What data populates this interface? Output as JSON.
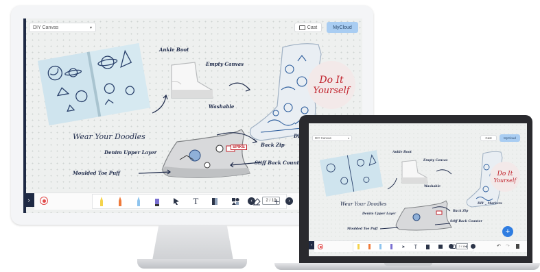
{
  "monitor": {
    "canvas_dropdown": {
      "value": "DIY Canvas"
    },
    "cast_button": "Cast",
    "mycloud_button": "MyCloud",
    "labels": {
      "ankle_boot": "Ankle Boot",
      "empty_canvas": "Empty Canvas",
      "washable": "Washable",
      "wear_your_doodles": "Wear Your Doodles",
      "denim_upper_layer": "Denim Upper Layer",
      "back_zip": "Back Zip",
      "stiff_back_counter": "Stiff Back Count",
      "moulded_toe_puff": "Moulded Toe Puff",
      "di_fragment": "DI",
      "do_it_yourself_1": "Do It",
      "do_it_yourself_2": "Yourself",
      "spike": "SPIKE"
    },
    "page_indicator": "2 / 10"
  },
  "laptop": {
    "canvas_dropdown": {
      "value": "DIY Canvas"
    },
    "cast_button": "Cast",
    "mycloud_button": "MyCloud",
    "labels": {
      "ankle_boot": "Ankle Boot",
      "empty_canvas": "Empty Canvas",
      "washable": "Washable",
      "wear_your_doodles": "Wear Your Doodles",
      "denim_upper_layer": "Denim Upper Layer",
      "back_zip": "Back Zip",
      "stiff_back_counter": "Stiff Back Counter",
      "moulded_toe_puff": "Moulded Toe Puff",
      "diy_markers": "DIY _ Markers",
      "do_it_yourself_1": "Do It",
      "do_it_yourself_2": "Yourself"
    },
    "page_indicator": "2 / 10",
    "fab_label": "+"
  },
  "icons": [
    "chevron-right-icon",
    "record-icon",
    "yellow-marker-icon",
    "orange-marker-icon",
    "blue-marker-icon",
    "purple-marker-icon",
    "pointer-icon",
    "text-icon",
    "notes-icon",
    "shapes-icon",
    "eraser-icon",
    "add-icon",
    "prev-page-icon",
    "next-page-icon",
    "cast-icon",
    "undo-icon",
    "redo-icon",
    "trash-icon"
  ],
  "colors": {
    "accent": "#a9cdf2",
    "sidebar": "#1f2a44",
    "record": "#e24b4b",
    "fab": "#2f7de1",
    "script_red": "#c0202a"
  }
}
